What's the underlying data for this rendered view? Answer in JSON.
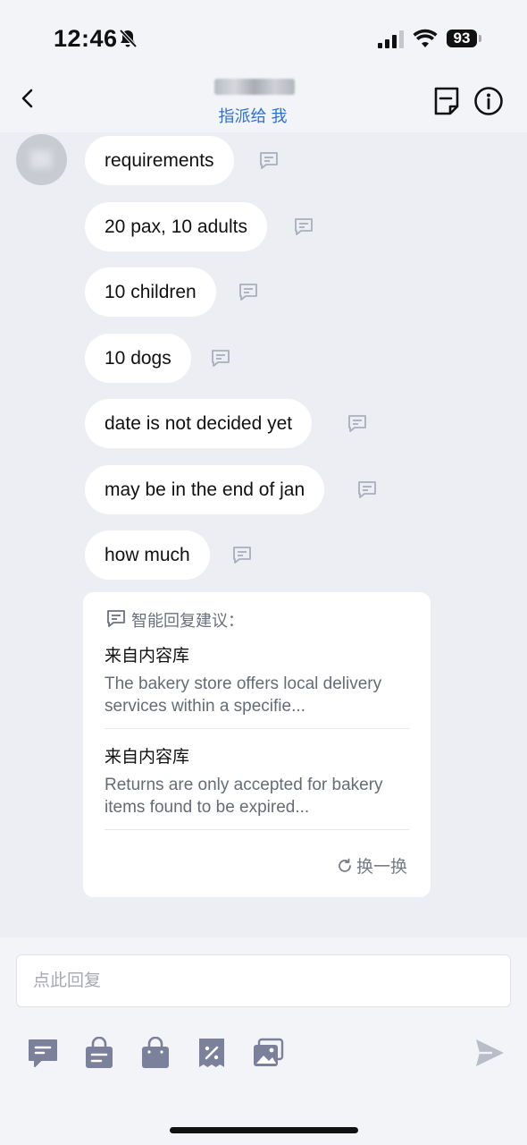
{
  "status_bar": {
    "time": "12:46",
    "battery": "93"
  },
  "header": {
    "assign_label": "指派给 我"
  },
  "messages": [
    {
      "text": "requirements"
    },
    {
      "text": "20 pax, 10 adults"
    },
    {
      "text": "10 children"
    },
    {
      "text": "10 dogs"
    },
    {
      "text": "date is not decided yet"
    },
    {
      "text": "may be in the end of jan"
    },
    {
      "text": "how much"
    }
  ],
  "suggestions": {
    "header": "智能回复建议：",
    "items": [
      {
        "source": "来自内容库",
        "text": "The bakery store offers local delivery services within a specifie..."
      },
      {
        "source": "来自内容库",
        "text": "Returns are only accepted for bakery items found to be expired..."
      }
    ],
    "refresh_label": "换一换"
  },
  "reply": {
    "placeholder": "点此回复",
    "value": ""
  },
  "toolbar": {
    "icons": [
      "quick-reply-icon",
      "order-icon",
      "product-bag-icon",
      "coupon-icon",
      "image-icon"
    ],
    "send_icon": "send-icon"
  },
  "colors": {
    "accent": "#2b6fd6",
    "background": "#eceef3",
    "icon": "#7b819a"
  }
}
